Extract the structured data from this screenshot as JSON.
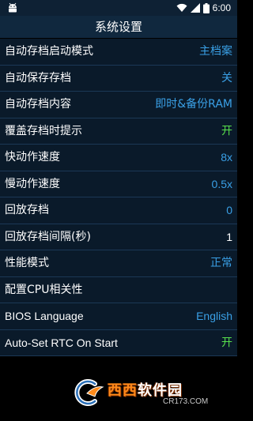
{
  "status_bar": {
    "time": "6:00"
  },
  "title": "系统设置",
  "settings": [
    {
      "label": "自动存档启动模式",
      "value": "主档案",
      "value_color": "#3aa0e6"
    },
    {
      "label": "自动保存存档",
      "value": "关",
      "value_color": "#3aa0e6"
    },
    {
      "label": "自动存档内容",
      "value": "即时&备份RAM",
      "value_color": "#3aa0e6"
    },
    {
      "label": "覆盖存档时提示",
      "value": "开",
      "value_color": "#58e04c"
    },
    {
      "label": "快动作速度",
      "value": "8x",
      "value_color": "#3aa0e6"
    },
    {
      "label": "慢动作速度",
      "value": "0.5x",
      "value_color": "#3aa0e6"
    },
    {
      "label": "回放存档",
      "value": "0",
      "value_color": "#3aa0e6"
    },
    {
      "label": "回放存档间隔(秒)",
      "value": "1",
      "value_color": "#ffffff"
    },
    {
      "label": "性能模式",
      "value": "正常",
      "value_color": "#3aa0e6"
    },
    {
      "label": "配置CPU相关性",
      "value": "",
      "value_color": "#ffffff"
    },
    {
      "label": "BIOS Language",
      "value": "English",
      "value_color": "#3aa0e6"
    },
    {
      "label": "Auto-Set RTC On Start",
      "value": "开",
      "value_color": "#58e04c"
    }
  ],
  "watermark": {
    "brand_a": "西西",
    "brand_b": "软件园",
    "url": "CR173.COM"
  }
}
